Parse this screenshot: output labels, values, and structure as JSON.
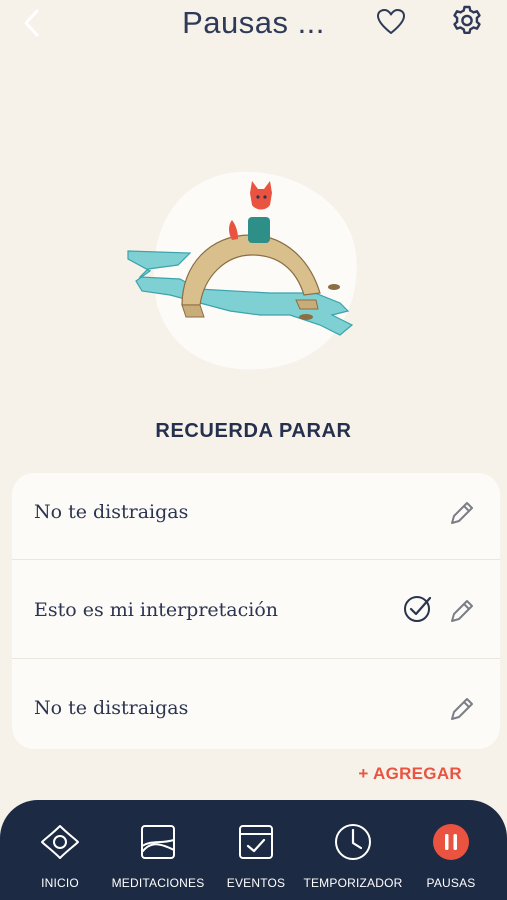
{
  "header": {
    "title": "Pausas ...",
    "back_icon": "chevron-left-icon",
    "favorite_icon": "heart-icon",
    "settings_icon": "gear-icon"
  },
  "section": {
    "title": "RECUERDA PARAR"
  },
  "reminders": [
    {
      "label": "No te distraigas",
      "checked": false
    },
    {
      "label": "Esto es mi interpretación",
      "checked": true
    },
    {
      "label": "No te distraigas",
      "checked": false
    }
  ],
  "add_label": "+ AGREGAR",
  "nav": [
    {
      "label": "INICIO",
      "icon": "eye-icon",
      "active": false
    },
    {
      "label": "MEDITACIONES",
      "icon": "image-icon",
      "active": false
    },
    {
      "label": "EVENTOS",
      "icon": "calendar-check-icon",
      "active": false
    },
    {
      "label": "TEMPORIZADOR",
      "icon": "clock-icon",
      "active": false
    },
    {
      "label": "PAUSAS",
      "icon": "pause-icon",
      "active": true
    }
  ],
  "colors": {
    "background": "#f6f2ea",
    "card": "#fdfbf8",
    "text": "#2b3550",
    "accent": "#e9533f",
    "nav_background": "#1d2a44"
  }
}
